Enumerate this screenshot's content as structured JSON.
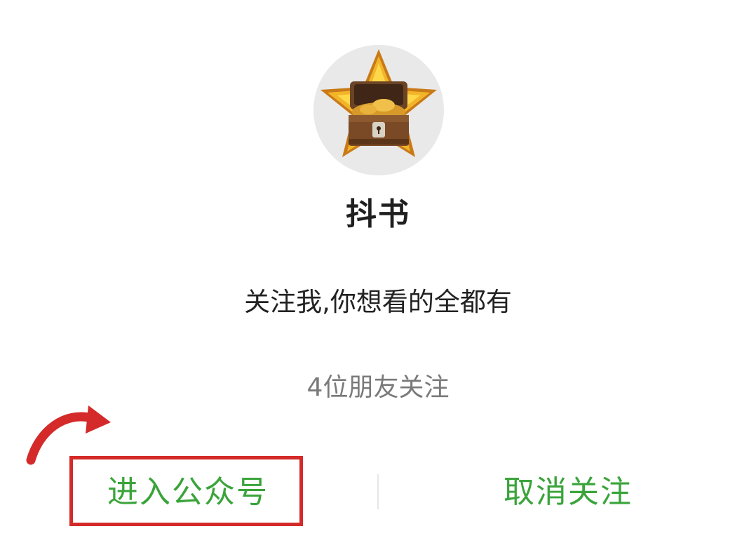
{
  "account": {
    "name": "抖书",
    "description": "关注我,你想看的全都有",
    "friends_following": "4位朋友关注"
  },
  "actions": {
    "enter_label": "进入公众号",
    "unfollow_label": "取消关注"
  },
  "colors": {
    "action_green": "#3aa43a",
    "highlight_red": "#d42a2a"
  },
  "icons": {
    "avatar": "star-treasure-chest-icon",
    "annotation": "curved-arrow-icon"
  }
}
